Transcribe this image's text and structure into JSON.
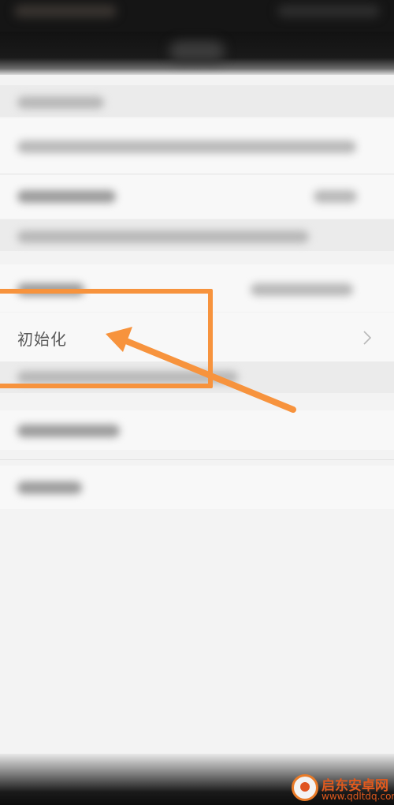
{
  "settings": {
    "init_item": {
      "label": "初始化"
    }
  },
  "icons": {
    "chevron": "chevron-right-icon",
    "annotation_arrow": "arrow-icon"
  },
  "annotation": {
    "color": "#f7933d"
  },
  "watermark": {
    "title": "启东安卓网",
    "url": "www.qdltdq.com",
    "color": "#e05a1e"
  }
}
